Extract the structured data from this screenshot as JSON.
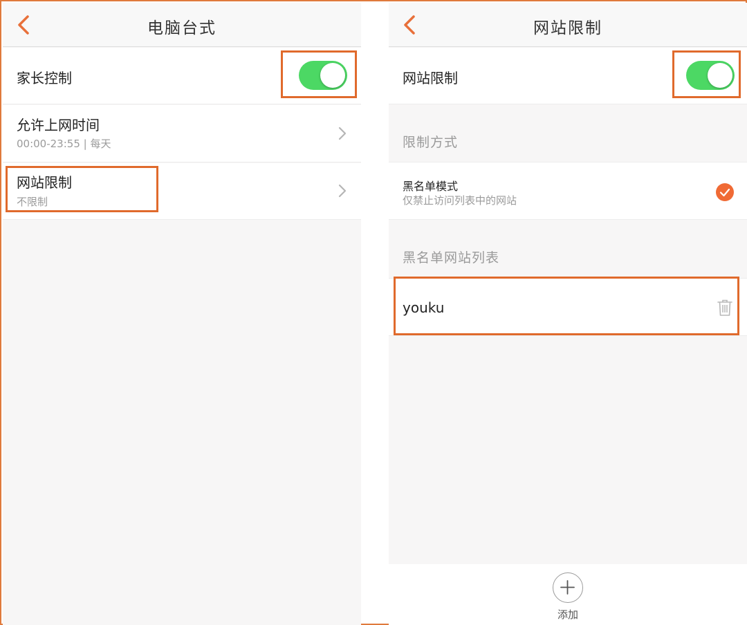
{
  "left": {
    "nav": {
      "title": "电脑台式"
    },
    "parental_control": {
      "label": "家长控制",
      "enabled": true
    },
    "online_time": {
      "label": "允许上网时间",
      "value": "00:00-23:55 | 每天"
    },
    "website_limit": {
      "label": "网站限制",
      "value": "不限制"
    }
  },
  "right": {
    "nav": {
      "title": "网站限制"
    },
    "website_limit": {
      "label": "网站限制",
      "enabled": true
    },
    "mode_section": {
      "header": "限制方式"
    },
    "blacklist_mode": {
      "label": "黑名单模式",
      "description": "仅禁止访问列表中的网站",
      "selected": true
    },
    "list_section": {
      "header": "黑名单网站列表"
    },
    "blacklist": [
      {
        "site": "youku"
      }
    ],
    "add": {
      "label": "添加"
    }
  },
  "colors": {
    "accent": "#f06a35",
    "toggle_on": "#4cd864",
    "highlight": "#e06a2c"
  },
  "icons": [
    "back-arrow-icon",
    "chevron-right-icon",
    "check-icon",
    "trash-icon",
    "plus-icon"
  ]
}
